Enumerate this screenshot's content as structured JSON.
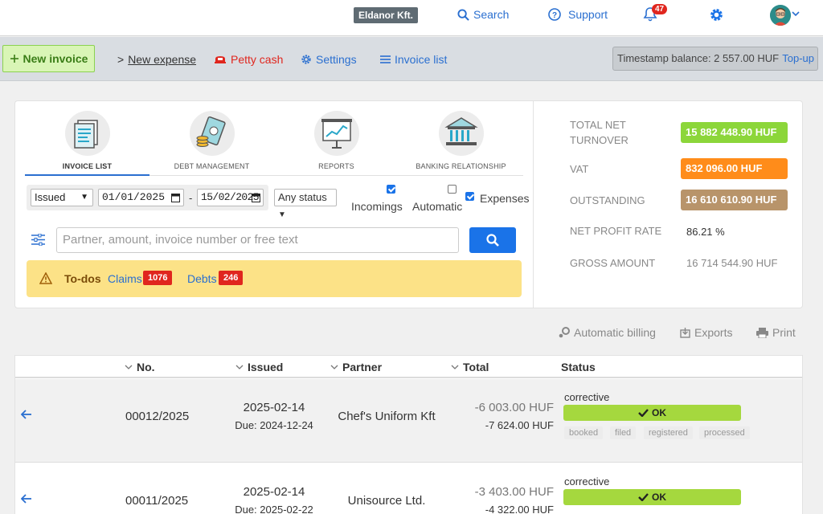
{
  "header": {
    "company": "Eldanor Kft.",
    "search_label": "Search",
    "support_label": "Support",
    "notification_count": "47"
  },
  "actionbar": {
    "new_invoice": "New invoice",
    "new_expense_prefix": ">",
    "new_expense": "New expense",
    "petty_cash": "Petty cash",
    "settings": "Settings",
    "invoice_list": "Invoice list",
    "balance": "Timestamp balance: 2 557.00 HUF",
    "topup": "Top-up"
  },
  "tabs": [
    {
      "label": "INVOICE LIST",
      "icon": "invoice-list-icon",
      "active": true
    },
    {
      "label": "DEBT MANAGEMENT",
      "icon": "debt-management-icon"
    },
    {
      "label": "REPORTS",
      "icon": "reports-icon"
    },
    {
      "label": "BANKING RELATIONSHIP",
      "icon": "bank-icon"
    }
  ],
  "filters": {
    "date_type": "Issued",
    "date_from": "01/01/2025",
    "date_to": "15/02/2025",
    "date_separator": "-",
    "status": "Any status",
    "incomings": "Incomings",
    "automatic": "Automatic",
    "expenses": "Expenses",
    "search_placeholder": "Partner, amount, invoice number or free text"
  },
  "todos": {
    "title": "To-dos",
    "claims_label": "Claims",
    "claims_count": "1076",
    "debts_label": "Debts",
    "debts_count": "246"
  },
  "stats": {
    "turnover_label_1": "TOTAL NET",
    "turnover_label_2": "TURNOVER",
    "turnover": "15 882 448.90 HUF",
    "vat_label": "VAT",
    "vat": "832 096.00 HUF",
    "outstanding_label": "OUTSTANDING",
    "outstanding": "16 610 610.90 HUF",
    "profit_label": "NET PROFIT RATE",
    "profit": "86.21 %",
    "gross_label": "GROSS AMOUNT",
    "gross": "16 714 544.90 HUF",
    "colors": {
      "turnover": "#8cd63a",
      "vat": "#ff8c1a",
      "outstanding": "#b8946a"
    }
  },
  "tools": {
    "automatic_billing": "Automatic billing",
    "exports": "Exports",
    "print": "Print"
  },
  "table": {
    "headers": {
      "no": "No.",
      "issued": "Issued",
      "partner": "Partner",
      "total": "Total",
      "status": "Status"
    },
    "rows": [
      {
        "no": "00012/2025",
        "issued": "2025-02-14",
        "due": "Due: 2024-12-24",
        "partner": "Chef's Uniform Kft",
        "net": "-6 003.00 HUF",
        "gross": "-7 624.00 HUF",
        "type": "corrective",
        "status": "OK",
        "tags": [
          "booked",
          "filed",
          "registered",
          "processed"
        ]
      },
      {
        "no": "00011/2025",
        "issued": "2025-02-14",
        "due": "Due: 2025-02-22",
        "partner": "Unisource Ltd.",
        "net": "-3 403.00 HUF",
        "gross": "-4 322.00 HUF",
        "type": "corrective",
        "status": "OK"
      }
    ]
  }
}
